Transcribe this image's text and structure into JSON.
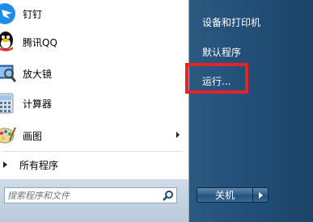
{
  "programs": [
    {
      "label": "钉钉",
      "icon": "dingtalk-icon",
      "has_submenu": false
    },
    {
      "label": "腾讯QQ",
      "icon": "qq-icon",
      "has_submenu": false
    },
    {
      "label": "放大镜",
      "icon": "magnifier-icon",
      "has_submenu": false
    },
    {
      "label": "计算器",
      "icon": "calculator-icon",
      "has_submenu": false
    },
    {
      "label": "画图",
      "icon": "paint-icon",
      "has_submenu": true
    }
  ],
  "all_programs_label": "所有程序",
  "search": {
    "placeholder": "搜索程序和文件"
  },
  "right_menu": {
    "devices_printers": "设备和打印机",
    "default_programs": "默认程序",
    "run": "运行..."
  },
  "shutdown": {
    "label": "关机"
  },
  "colors": {
    "highlight": "#e2232a",
    "panel_blue": "#23507a"
  }
}
